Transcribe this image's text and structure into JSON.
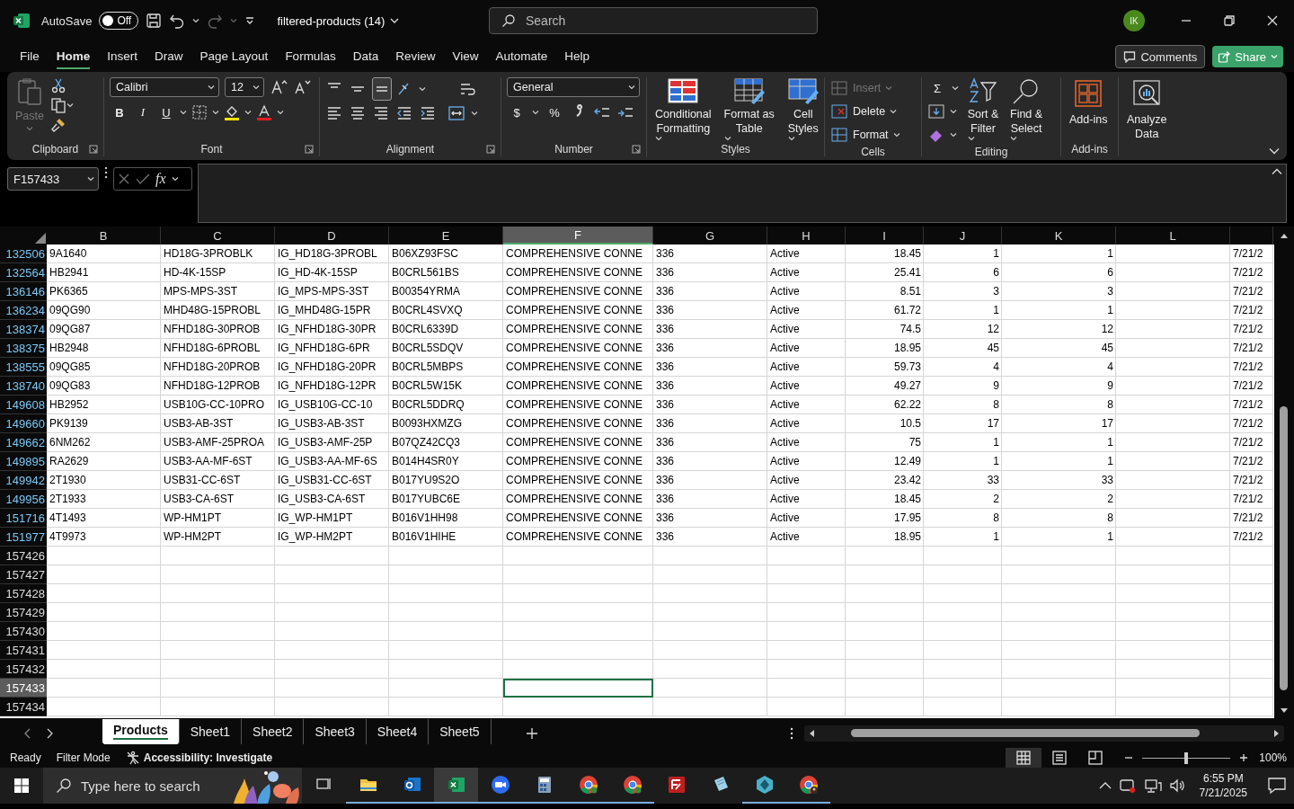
{
  "title_bar": {
    "autosave_label": "AutoSave",
    "autosave": {
      "label": "Off",
      "on": false
    },
    "filename": "filtered-products (14)",
    "search": {
      "placeholder": "Search"
    },
    "avatar": "IK"
  },
  "menu_tabs": [
    {
      "label": "File",
      "selected": false
    },
    {
      "label": "Home",
      "selected": true
    },
    {
      "label": "Insert",
      "selected": false
    },
    {
      "label": "Draw",
      "selected": false
    },
    {
      "label": "Page Layout",
      "selected": false
    },
    {
      "label": "Formulas",
      "selected": false
    },
    {
      "label": "Data",
      "selected": false
    },
    {
      "label": "Review",
      "selected": false
    },
    {
      "label": "View",
      "selected": false
    },
    {
      "label": "Automate",
      "selected": false
    },
    {
      "label": "Help",
      "selected": false
    }
  ],
  "comments_button": "Comments",
  "share_button": "Share",
  "ribbon": [
    {
      "kind": "clipboard",
      "label": "Clipboard",
      "launcher": true,
      "paste": {
        "label": "Paste",
        "disabled": true
      }
    },
    {
      "kind": "font",
      "label": "Font",
      "launcher": true,
      "font_name": "Calibri",
      "font_size": "12",
      "bold": "B",
      "italic": "I",
      "underline": "U"
    },
    {
      "kind": "alignment",
      "label": "Alignment",
      "launcher": true
    },
    {
      "kind": "number",
      "label": "Number",
      "launcher": true,
      "format": "General",
      "currency": "$",
      "percent": "%"
    },
    {
      "kind": "styles",
      "label": "Styles",
      "buttons": [
        {
          "lines": [
            "Conditional",
            "Formatting"
          ]
        },
        {
          "lines": [
            "Format as",
            "Table"
          ]
        },
        {
          "lines": [
            "Cell",
            "Styles"
          ]
        }
      ]
    },
    {
      "kind": "cells",
      "label": "Cells",
      "buttons": [
        {
          "label": "Insert",
          "disabled": true
        },
        {
          "label": "Delete",
          "disabled": false
        },
        {
          "label": "Format",
          "disabled": false
        }
      ]
    },
    {
      "kind": "editing",
      "label": "Editing",
      "sum": "Σ",
      "buttons": [
        {
          "lines": [
            "Sort &",
            "Filter"
          ]
        },
        {
          "lines": [
            "Find &",
            "Select"
          ]
        }
      ]
    },
    {
      "kind": "addins",
      "label": "Add-ins",
      "buttons": [
        {
          "lines": [
            "Add-ins"
          ]
        }
      ]
    },
    {
      "kind": "analyze",
      "buttons": [
        {
          "lines": [
            "Analyze",
            "Data"
          ]
        }
      ]
    }
  ],
  "formula_bar": {
    "name_box": "F157433",
    "fx": "fx"
  },
  "columns": [
    {
      "label": "B",
      "selected": false
    },
    {
      "label": "C",
      "selected": false
    },
    {
      "label": "D",
      "selected": false
    },
    {
      "label": "E",
      "selected": false
    },
    {
      "label": "F",
      "selected": true
    },
    {
      "label": "G",
      "selected": false
    },
    {
      "label": "H",
      "selected": false
    },
    {
      "label": "I",
      "selected": false
    },
    {
      "label": "J",
      "selected": false
    },
    {
      "label": "K",
      "selected": false
    },
    {
      "label": "L",
      "selected": false
    }
  ],
  "rows": [
    {
      "number": "132506",
      "filtered": true,
      "selected": false,
      "cells": [
        "9A1640",
        "HD18G-3PROBLK",
        "IG_HD18G-3PROBL",
        "B06XZ93FSC",
        "COMPREHENSIVE CONNE",
        "336",
        "Active",
        "18.45",
        "1",
        "1",
        "",
        "7/21/2"
      ]
    },
    {
      "number": "132564",
      "filtered": true,
      "selected": false,
      "cells": [
        "HB2941",
        "HD-4K-15SP",
        "IG_HD-4K-15SP",
        "B0CRL561BS",
        "COMPREHENSIVE CONNE",
        "336",
        "Active",
        "25.41",
        "6",
        "6",
        "",
        "7/21/2"
      ]
    },
    {
      "number": "136146",
      "filtered": true,
      "selected": false,
      "cells": [
        "PK6365",
        "MPS-MPS-3ST",
        "IG_MPS-MPS-3ST",
        "B00354YRMA",
        "COMPREHENSIVE CONNE",
        "336",
        "Active",
        "8.51",
        "3",
        "3",
        "",
        "7/21/2"
      ]
    },
    {
      "number": "136234",
      "filtered": true,
      "selected": false,
      "cells": [
        "09QG90",
        "MHD48G-15PROBL",
        "IG_MHD48G-15PR",
        "B0CRL4SVXQ",
        "COMPREHENSIVE CONNE",
        "336",
        "Active",
        "61.72",
        "1",
        "1",
        "",
        "7/21/2"
      ]
    },
    {
      "number": "138374",
      "filtered": true,
      "selected": false,
      "cells": [
        "09QG87",
        "NFHD18G-30PROB",
        "IG_NFHD18G-30PR",
        "B0CRL6339D",
        "COMPREHENSIVE CONNE",
        "336",
        "Active",
        "74.5",
        "12",
        "12",
        "",
        "7/21/2"
      ]
    },
    {
      "number": "138375",
      "filtered": true,
      "selected": false,
      "cells": [
        "HB2948",
        "NFHD18G-6PROBL",
        "IG_NFHD18G-6PR",
        "B0CRL5SDQV",
        "COMPREHENSIVE CONNE",
        "336",
        "Active",
        "18.95",
        "45",
        "45",
        "",
        "7/21/2"
      ]
    },
    {
      "number": "138555",
      "filtered": true,
      "selected": false,
      "cells": [
        "09QG85",
        "NFHD18G-20PROB",
        "IG_NFHD18G-20PR",
        "B0CRL5MBPS",
        "COMPREHENSIVE CONNE",
        "336",
        "Active",
        "59.73",
        "4",
        "4",
        "",
        "7/21/2"
      ]
    },
    {
      "number": "138740",
      "filtered": true,
      "selected": false,
      "cells": [
        "09QG83",
        "NFHD18G-12PROB",
        "IG_NFHD18G-12PR",
        "B0CRL5W15K",
        "COMPREHENSIVE CONNE",
        "336",
        "Active",
        "49.27",
        "9",
        "9",
        "",
        "7/21/2"
      ]
    },
    {
      "number": "149608",
      "filtered": true,
      "selected": false,
      "cells": [
        "HB2952",
        "USB10G-CC-10PRO",
        "IG_USB10G-CC-10",
        "B0CRL5DDRQ",
        "COMPREHENSIVE CONNE",
        "336",
        "Active",
        "62.22",
        "8",
        "8",
        "",
        "7/21/2"
      ]
    },
    {
      "number": "149660",
      "filtered": true,
      "selected": false,
      "cells": [
        "PK9139",
        "USB3-AB-3ST",
        "IG_USB3-AB-3ST",
        "B0093HXMZG",
        "COMPREHENSIVE CONNE",
        "336",
        "Active",
        "10.5",
        "17",
        "17",
        "",
        "7/21/2"
      ]
    },
    {
      "number": "149662",
      "filtered": true,
      "selected": false,
      "cells": [
        "6NM262",
        "USB3-AMF-25PROA",
        "IG_USB3-AMF-25P",
        "B07QZ42CQ3",
        "COMPREHENSIVE CONNE",
        "336",
        "Active",
        "75",
        "1",
        "1",
        "",
        "7/21/2"
      ]
    },
    {
      "number": "149895",
      "filtered": true,
      "selected": false,
      "cells": [
        "RA2629",
        "USB3-AA-MF-6ST",
        "IG_USB3-AA-MF-6S",
        "B014H4SR0Y",
        "COMPREHENSIVE CONNE",
        "336",
        "Active",
        "12.49",
        "1",
        "1",
        "",
        "7/21/2"
      ]
    },
    {
      "number": "149942",
      "filtered": true,
      "selected": false,
      "cells": [
        "2T1930",
        "USB31-CC-6ST",
        "IG_USB31-CC-6ST",
        "B017YU9S2O",
        "COMPREHENSIVE CONNE",
        "336",
        "Active",
        "23.42",
        "33",
        "33",
        "",
        "7/21/2"
      ]
    },
    {
      "number": "149956",
      "filtered": true,
      "selected": false,
      "cells": [
        "2T1933",
        "USB3-CA-6ST",
        "IG_USB3-CA-6ST",
        "B017YUBC6E",
        "COMPREHENSIVE CONNE",
        "336",
        "Active",
        "18.45",
        "2",
        "2",
        "",
        "7/21/2"
      ]
    },
    {
      "number": "151716",
      "filtered": true,
      "selected": false,
      "cells": [
        "4T1493",
        "WP-HM1PT",
        "IG_WP-HM1PT",
        "B016V1HH98",
        "COMPREHENSIVE CONNE",
        "336",
        "Active",
        "17.95",
        "8",
        "8",
        "",
        "7/21/2"
      ]
    },
    {
      "number": "151977",
      "filtered": true,
      "selected": false,
      "cells": [
        "4T9973",
        "WP-HM2PT",
        "IG_WP-HM2PT",
        "B016V1HIHE",
        "COMPREHENSIVE CONNE",
        "336",
        "Active",
        "18.95",
        "1",
        "1",
        "",
        "7/21/2"
      ]
    },
    {
      "number": "157426",
      "filtered": false,
      "selected": false
    },
    {
      "number": "157427",
      "filtered": false,
      "selected": false
    },
    {
      "number": "157428",
      "filtered": false,
      "selected": false
    },
    {
      "number": "157429",
      "filtered": false,
      "selected": false
    },
    {
      "number": "157430",
      "filtered": false,
      "selected": false
    },
    {
      "number": "157431",
      "filtered": false,
      "selected": false
    },
    {
      "number": "157432",
      "filtered": false,
      "selected": false
    },
    {
      "number": "157433",
      "filtered": false,
      "selected": true
    },
    {
      "number": "157434",
      "filtered": false,
      "selected": false
    }
  ],
  "sheet_tabs": [
    {
      "label": "Products",
      "selected": true
    },
    {
      "label": "Sheet1",
      "selected": false
    },
    {
      "label": "Sheet2",
      "selected": false
    },
    {
      "label": "Sheet3",
      "selected": false
    },
    {
      "label": "Sheet4",
      "selected": false
    },
    {
      "label": "Sheet5",
      "selected": false
    }
  ],
  "status_bar": {
    "ready": "Ready",
    "mode": "Filter Mode",
    "accessibility": "Accessibility: Investigate",
    "views": [
      {
        "kind": "normal",
        "selected": true
      },
      {
        "kind": "page-layout",
        "selected": false
      },
      {
        "kind": "page-break",
        "selected": false
      }
    ],
    "zoom": {
      "level": 0.5,
      "label": "100%"
    }
  },
  "taskbar": {
    "search": {
      "placeholder": "Type here to search"
    },
    "apps": [
      {
        "kind": "task-view",
        "open": false,
        "selected": false
      },
      {
        "kind": "folder",
        "open": true,
        "selected": false
      },
      {
        "kind": "mail",
        "open": true,
        "selected": false
      },
      {
        "kind": "spreadsheet",
        "open": true,
        "selected": true
      },
      {
        "kind": "video",
        "open": true,
        "selected": false
      },
      {
        "kind": "calculator",
        "open": true,
        "selected": false
      },
      {
        "kind": "browser",
        "open": true,
        "selected": false
      },
      {
        "kind": "browser",
        "open": true,
        "selected": false
      },
      {
        "kind": "ftp",
        "open": false,
        "selected": false
      },
      {
        "kind": "notepad",
        "open": false,
        "selected": false
      },
      {
        "kind": "diamond",
        "open": true,
        "selected": false
      },
      {
        "kind": "browser-profile",
        "open": true,
        "selected": false
      }
    ],
    "time": "6:55 PM",
    "date": "7/21/2025"
  }
}
